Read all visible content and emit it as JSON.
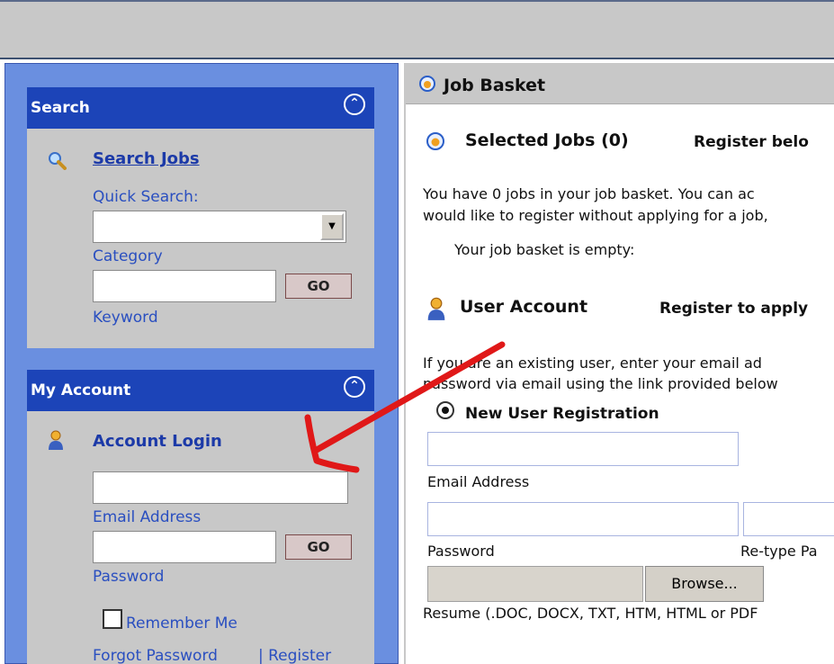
{
  "left": {
    "search": {
      "title": "Search",
      "search_jobs": "Search Jobs",
      "quick_search": "Quick Search:",
      "category": "Category",
      "go": "GO",
      "keyword": "Keyword"
    },
    "account": {
      "title": "My Account",
      "account_login": "Account Login",
      "email": "Email Address",
      "go": "GO",
      "password": "Password",
      "remember": "Remember Me",
      "forgot": "Forgot Password",
      "register": "| Register"
    }
  },
  "right": {
    "title": "Job Basket",
    "selected_jobs": "Selected Jobs (0)",
    "register_below": "Register belo",
    "basket_line1": "You have 0  jobs in your job basket. You can ac",
    "basket_line2": "would like to register without applying for a job,",
    "basket_empty": "Your job basket is empty:",
    "user_account": "User Account",
    "register_to_apply": "Register to apply",
    "user_line1": "If you are an existing user, enter your email ad",
    "user_line2": "password via email using the link provided below",
    "new_user": "New User Registration",
    "email_label": "Email Address",
    "password_label": "Password",
    "retype_label": "Re-type Pa",
    "browse": "Browse...",
    "resume_label": "Resume (.DOC, DOCX, TXT, HTM, HTML or PDF"
  },
  "colors": {
    "panel_header": "#1c44b8",
    "left_bg": "#6a8fe0",
    "panel_body": "#c8c8c8",
    "annotation_arrow": "#e01818"
  },
  "icons": [
    "search-magnifier-icon",
    "user-icon",
    "collapse-icon",
    "basket-icon",
    "user-account-icon"
  ]
}
